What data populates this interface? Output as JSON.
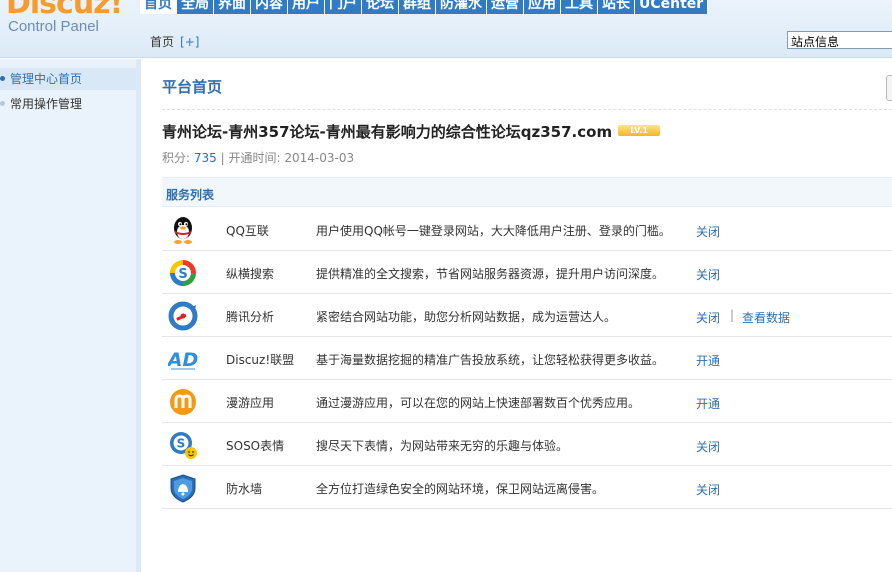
{
  "header": {
    "logo_text": "Discuz!",
    "logo_sub": "Control Panel",
    "nav": [
      "首页",
      "全局",
      "界面",
      "内容",
      "用户",
      "门户",
      "论坛",
      "群组",
      "防灌水",
      "运营",
      "应用",
      "工具",
      "站长",
      "UCenter"
    ],
    "breadcrumb": "首页",
    "breadcrumb_add": "[+]",
    "site_select": "站点信息"
  },
  "sidebar": {
    "items": [
      {
        "label": "管理中心首页"
      },
      {
        "label": "常用操作管理"
      }
    ]
  },
  "main": {
    "title": "平台首页",
    "site_title": "青州论坛-青州357论坛-青州最有影响力的综合性论坛qz357.com",
    "level_badge": "LV.1",
    "points_label": "积分:",
    "points_value": "735",
    "open_label": "| 开通时间:",
    "open_date": "2014-03-03",
    "services_header": "服务列表",
    "services": [
      {
        "icon": "qq-penguin-icon",
        "name": "QQ互联",
        "desc": "用户使用QQ帐号一键登录网站，大大降低用户注册、登录的门槛。",
        "action": "关闭"
      },
      {
        "icon": "soso-search-icon",
        "name": "纵横搜索",
        "desc": "提供精准的全文搜索，节省网站服务器资源，提升用户访问深度。",
        "action": "关闭"
      },
      {
        "icon": "tencent-analytics-icon",
        "name": "腾讯分析",
        "desc": "紧密结合网站功能，助您分析网站数据，成为运营达人。",
        "action": "关闭",
        "sep": "|",
        "action2": "查看数据"
      },
      {
        "icon": "ad-union-icon",
        "name": "Discuz!联盟",
        "desc": "基于海量数据挖掘的精准广告投放系统，让您轻松获得更多收益。",
        "action": "开通"
      },
      {
        "icon": "manyou-app-icon",
        "name": "漫游应用",
        "desc": "通过漫游应用，可以在您的网站上快速部署数百个优秀应用。",
        "action": "开通"
      },
      {
        "icon": "soso-emoticon-icon",
        "name": "SOSO表情",
        "desc": "搜尽天下表情，为网站带来无穷的乐趣与体验。",
        "action": "关闭"
      },
      {
        "icon": "firewall-shield-icon",
        "name": "防水墙",
        "desc": "全方位打造绿色安全的网站环境，保卫网站远离侵害。",
        "action": "关闭"
      }
    ]
  }
}
